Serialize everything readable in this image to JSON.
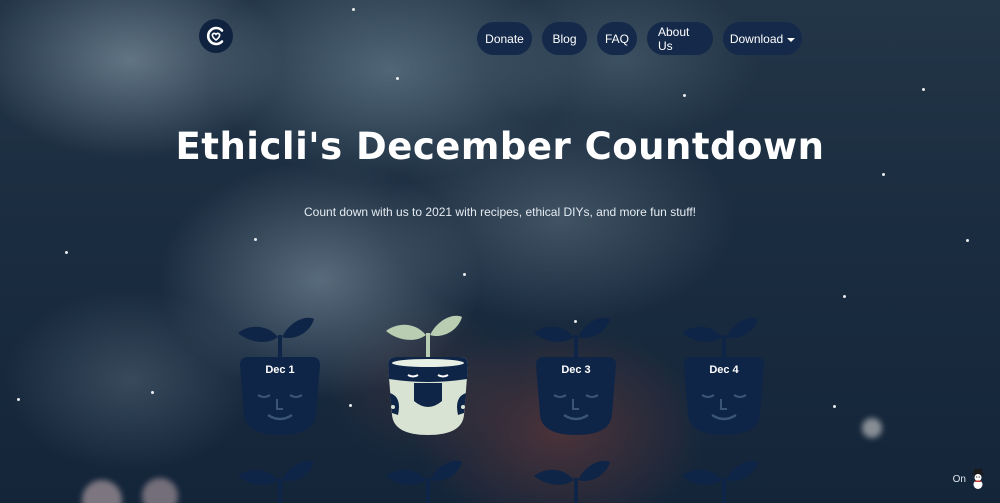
{
  "header": {
    "logo_icon": "ethicli-heart-logo-icon",
    "nav": [
      {
        "label": "Donate"
      },
      {
        "label": "Blog"
      },
      {
        "label": "FAQ"
      },
      {
        "label": "About Us"
      },
      {
        "label": "Download",
        "has_dropdown": true
      }
    ]
  },
  "hero": {
    "title": "Ethicli's December Countdown",
    "subtitle": "Count down with us to 2021 with recipes, ethical DIYs, and more fun stuff!"
  },
  "countdown": {
    "days": [
      {
        "label": "Dec 1",
        "state": "closed",
        "pot_color": "#0f2547",
        "sprout_color": "#0f2547"
      },
      {
        "label": "",
        "state": "opened",
        "pot_color": "#0f2547",
        "sprout_color": "#b9cdb2"
      },
      {
        "label": "Dec 3",
        "state": "closed",
        "pot_color": "#0f2547",
        "sprout_color": "#0f2547"
      },
      {
        "label": "Dec 4",
        "state": "closed",
        "pot_color": "#0f2547",
        "sprout_color": "#0f2547"
      }
    ]
  },
  "snow_toggle": {
    "label": "On",
    "icon": "snowman-icon"
  },
  "colors": {
    "nav_bg": "#15294a",
    "pot_dark": "#0f2547",
    "pot_light": "#d9e3d4",
    "sprout_light": "#b9cdb2"
  }
}
